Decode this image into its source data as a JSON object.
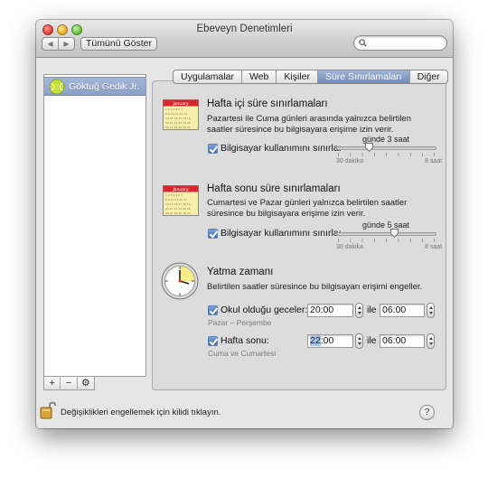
{
  "window": {
    "title": "Ebeveyn Denetimleri",
    "nav_back": "◀",
    "nav_forward": "▶",
    "show_all": "Tümünü Göster",
    "search_placeholder": ""
  },
  "sidebar": {
    "users": [
      {
        "name": "Göktuğ Gedik Jr."
      }
    ],
    "buttons": {
      "add": "+",
      "remove": "−",
      "action": "⚙"
    }
  },
  "tabs": [
    "Uygulamalar",
    "Web",
    "Kişiler",
    "Süre Sınırlamaları",
    "Diğer"
  ],
  "active_tab": "Süre Sınırlamaları",
  "weekday": {
    "title": "Hafta içi süre sınırlamaları",
    "description": "Pazartesi ile Cuma günleri arasında yalnızca belirtilen saatler süresince bu bilgisayara erişime izin verir.",
    "checkbox_label": "Bilgisayar kullanımını sınırla:",
    "checked": true,
    "value_label": "günde 3 saat",
    "min_label": "30 dakika",
    "max_label": "8 saat",
    "calendar_month": "January",
    "slider_fraction": 0.32
  },
  "weekend": {
    "title": "Hafta sonu süre sınırlamaları",
    "description": "Cumartesi ve Pazar günleri yalnızca belirtilen saatler süresince bu bilgisayara erişime izin verir.",
    "checkbox_label": "Bilgisayar kullanımını sınırla:",
    "checked": true,
    "value_label": "günde 5 saat",
    "min_label": "30 dakika",
    "max_label": "8 saat",
    "calendar_month": "January",
    "slider_fraction": 0.58
  },
  "bedtime": {
    "title": "Yatma zamanı",
    "description": "Belirtilen saatler süresince bu bilgisayarı erişimi engeller.",
    "school_nights": {
      "label": "Okul olduğu geceler:",
      "checked": true,
      "sublabel": "Pazar – Perşembe",
      "from": "20:00",
      "to": "06:00"
    },
    "weekend": {
      "label": "Hafta sonu:",
      "checked": true,
      "sublabel": "Cuma ve Cumartesi",
      "from_hour": "22",
      "from_rest": ":00",
      "to": "06:00"
    },
    "to_label": "ile"
  },
  "status": {
    "lock_text": "Değişiklikleri engellemek için kilidi tıklayın.",
    "help": "?"
  }
}
